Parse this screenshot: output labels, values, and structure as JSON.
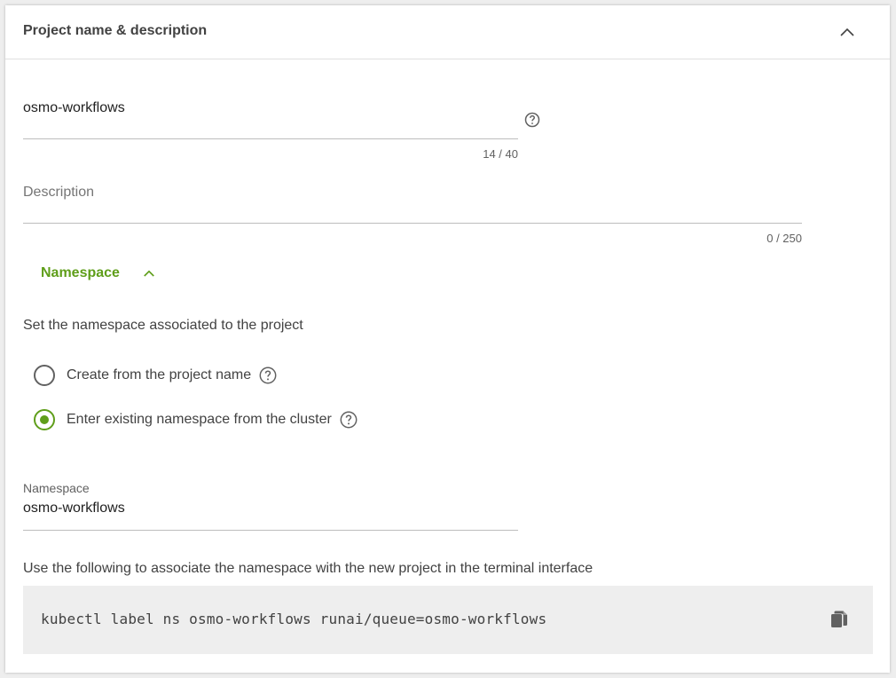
{
  "header": {
    "title": "Project name & description"
  },
  "project_name": {
    "value": "osmo-workflows",
    "counter": "14 / 40"
  },
  "description": {
    "placeholder": "Description",
    "counter": "0 / 250"
  },
  "namespace_section": {
    "toggle_label": "Namespace",
    "instruction": "Set the namespace associated to the project",
    "options": [
      {
        "label": "Create from the project name",
        "selected": false
      },
      {
        "label": "Enter existing namespace from the cluster",
        "selected": true
      }
    ],
    "field_label": "Namespace",
    "field_value": "osmo-workflows",
    "terminal_hint": "Use the following to associate the namespace with the new project in the terminal interface",
    "command": "kubectl label ns osmo-workflows runai/queue=osmo-workflows"
  },
  "colors": {
    "accent": "#5f9e1a",
    "code_bg": "#eeeeee"
  },
  "icons": {
    "collapse": "chevron-up-icon",
    "help": "help-circle-icon",
    "copy": "copy-icon"
  }
}
